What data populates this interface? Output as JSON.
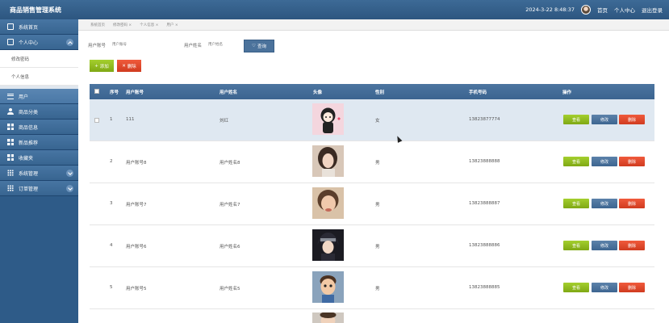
{
  "app": {
    "title": "商品销售管理系统"
  },
  "topbar": {
    "datetime": "2024-3-22 8:48:37",
    "home": "首页",
    "profile": "个人中心",
    "logout": "退出登录"
  },
  "sidebar": {
    "home": "系统首页",
    "personal": "个人中心",
    "personal_sub": [
      "修改密码",
      "个人信息"
    ],
    "users": "用户",
    "category": "商品分类",
    "goods_info": "商品信息",
    "recommend": "新品推荐",
    "favorites": "收藏夹",
    "system": "系统管理",
    "orders": "订单管理"
  },
  "breadcrumb": [
    "系统首页",
    "修改密码 ×",
    "个人信息 ×",
    "用户 ×"
  ],
  "search": {
    "account_label": "用户账号",
    "account_placeholder": "用户账号",
    "name_label": "用户姓名",
    "name_placeholder": "用户姓名",
    "query_button": "查询"
  },
  "toolbar": {
    "add": "添加",
    "delete": "删除"
  },
  "table": {
    "headers": {
      "index": "序号",
      "account": "用户账号",
      "name": "用户姓名",
      "avatar": "头像",
      "gender": "性别",
      "phone": "手机号码",
      "ops": "操作"
    },
    "rows": [
      {
        "index": "1",
        "account": "111",
        "name": "刘红",
        "gender": "女",
        "phone": "13823877774"
      },
      {
        "index": "2",
        "account": "用户账号8",
        "name": "用户姓名8",
        "gender": "男",
        "phone": "13823888888"
      },
      {
        "index": "3",
        "account": "用户账号7",
        "name": "用户姓名7",
        "gender": "男",
        "phone": "13823888887"
      },
      {
        "index": "4",
        "account": "用户账号6",
        "name": "用户姓名6",
        "gender": "男",
        "phone": "13823888886"
      },
      {
        "index": "5",
        "account": "用户账号5",
        "name": "用户姓名5",
        "gender": "男",
        "phone": "13823888885"
      }
    ],
    "ops": {
      "view": "查看",
      "edit": "修改",
      "remove": "删除"
    }
  },
  "colors": {
    "header_blue": "#3b6490",
    "add_green": "#8bb51c",
    "delete_red": "#e04a2c",
    "highlight_row": "#dfe8f1"
  }
}
